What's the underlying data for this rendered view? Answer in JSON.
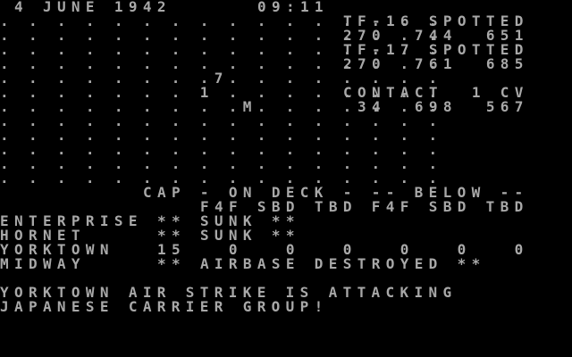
{
  "header": {
    "date": "4 JUNE 1942",
    "time": "09:11"
  },
  "map": {
    "rows": [
      ". . . . . . . . . . . . . . . .",
      ". . . . . . . . . . . . . . . .",
      ". . . . . . . . . . . . . . . .",
      ". . . . . . . . . . . . . . . .",
      ". . . . . . . .7. . . . . . . .",
      ". . . . . . . 1 . . . . . . . .",
      ". . . . . . . . .M. . . . . . .",
      ". . . . . . . . . . . . . . . .",
      ". . . . . . . . . . . . . . . .",
      ". . . . . . . . . . . . . . . .",
      ". . . . . . . . . . . . . . . .",
      ". . . . . . . . . . . . . . . ."
    ]
  },
  "reports": {
    "tf16_title": "TF-16 SPOTTED",
    "tf16_values": "270  744  651",
    "tf17_title": "TF-17 SPOTTED",
    "tf17_values": "270  761  685",
    "contact_title": "CONTACT  1 CV",
    "contact_values": " 34  698  567"
  },
  "table": {
    "header_group": "CAP - ON DECK - -- BELOW --",
    "header_cols": "F4F SBD TBD F4F SBD TBD",
    "rows": [
      {
        "name": "ENTERPRISE",
        "status": "** SUNK **"
      },
      {
        "name": "HORNET",
        "status": "** SUNK **"
      },
      {
        "name": "YORKTOWN",
        "status": "15   0   0   0   0   0   0"
      },
      {
        "name": "MIDWAY",
        "status": "** AIRBASE DESTROYED **"
      }
    ]
  },
  "message": {
    "line1": "YORKTOWN AIR STRIKE IS ATTACKING",
    "line2": "JAPANESE CARRIER GROUP!"
  }
}
